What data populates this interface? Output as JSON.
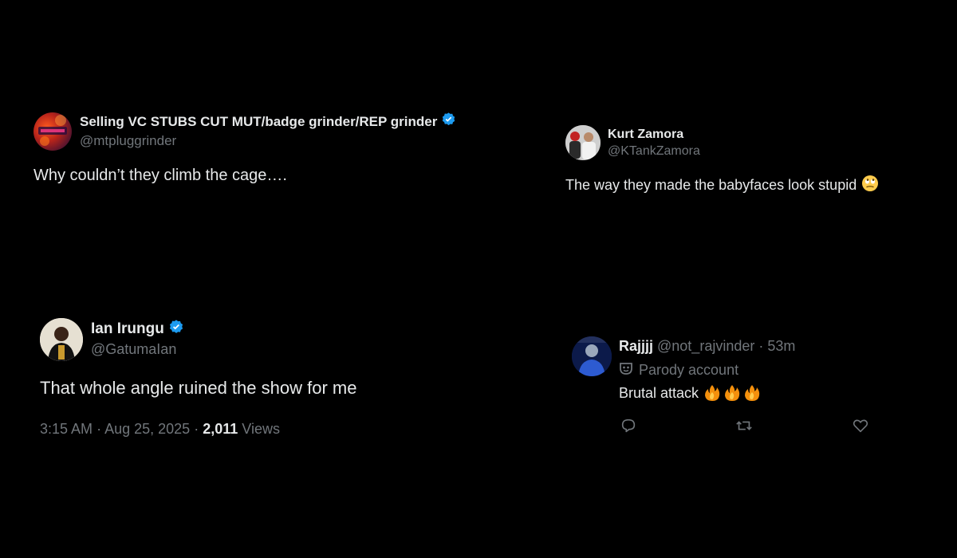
{
  "tweets": [
    {
      "name": "Selling VC STUBS CUT MUT/badge grinder/REP grinder",
      "handle": "@mtpluggrinder",
      "text": "Why couldn’t they climb the cage….",
      "verified": true
    },
    {
      "name": "Kurt Zamora",
      "handle": "@KTankZamora",
      "text": "The way they made the babyfaces look stupid",
      "emoji": "face-with-rolling-eyes"
    },
    {
      "name": "Ian Irungu",
      "handle": "@GatumaIan",
      "text": "That whole angle ruined the show for me",
      "verified": true,
      "time": "3:15 AM",
      "sep1": "·",
      "date": "Aug 25, 2025",
      "sep2": "·",
      "views_count": "2,011",
      "views_label": "Views"
    },
    {
      "name": "Rajjjj",
      "handle": "@not_rajvinder",
      "sep": "·",
      "time_ago": "53m",
      "parody_label": "Parody account",
      "text": "Brutal attack",
      "emoji": "fire x3",
      "actions": [
        "reply-icon",
        "retweet-icon",
        "like-icon"
      ]
    }
  ],
  "colors": {
    "background": "#000000",
    "primary_text": "#e7e9ea",
    "secondary_text": "#71767b",
    "verified_blue": "#1d9bf0"
  }
}
